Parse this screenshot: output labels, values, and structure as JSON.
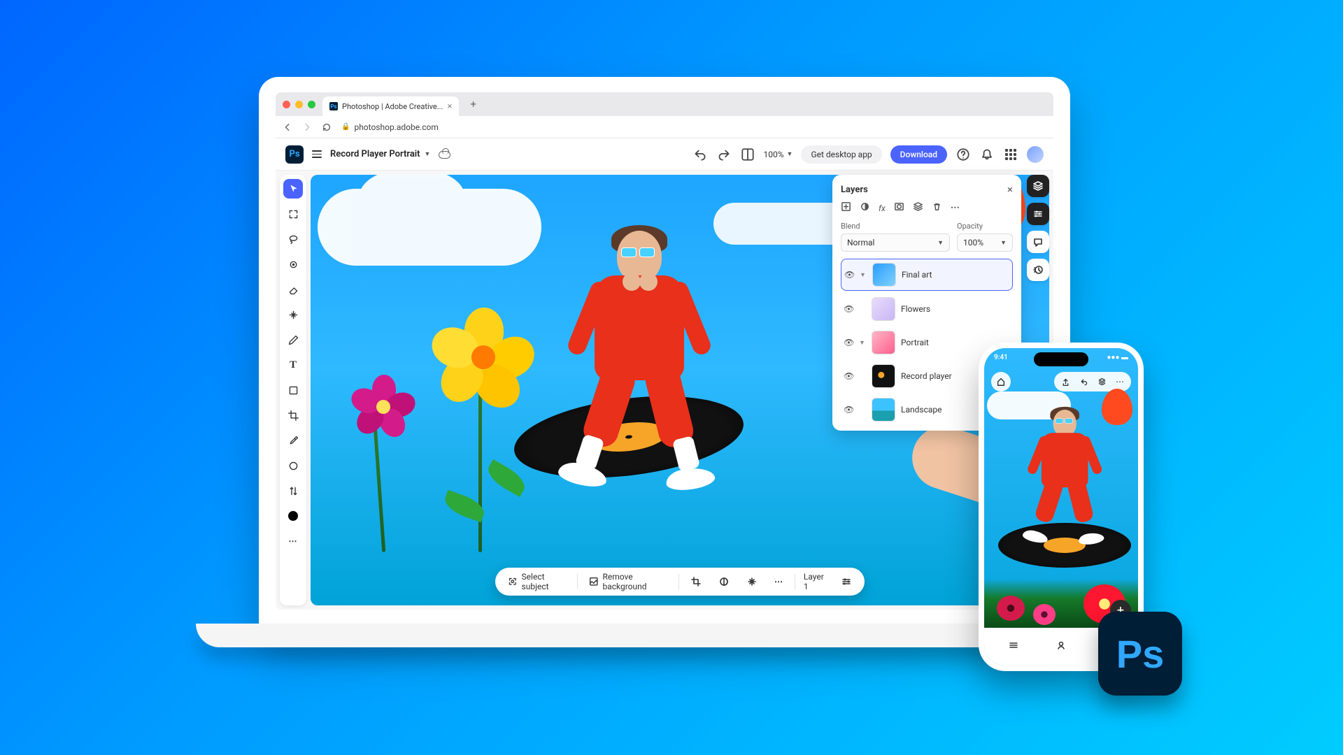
{
  "browser": {
    "tab_title": "Photoshop | Adobe Creative...",
    "url": "photoshop.adobe.com"
  },
  "app": {
    "logo": "Ps",
    "doc_title": "Record Player Portrait",
    "zoom": "100%",
    "get_desktop": "Get desktop app",
    "download": "Download"
  },
  "context_bar": {
    "select_subject": "Select subject",
    "remove_bg": "Remove background",
    "layer_label": "Layer 1"
  },
  "layers_panel": {
    "title": "Layers",
    "blend_label": "Blend",
    "blend_value": "Normal",
    "opacity_label": "Opacity",
    "opacity_value": "100%",
    "items": [
      {
        "name": "Final art",
        "has_children": true
      },
      {
        "name": "Flowers",
        "has_children": false
      },
      {
        "name": "Portrait",
        "has_children": true
      },
      {
        "name": "Record player",
        "has_children": false
      },
      {
        "name": "Landscape",
        "has_children": false
      }
    ]
  },
  "phone": {
    "time": "9:41",
    "logo": "Ps"
  }
}
